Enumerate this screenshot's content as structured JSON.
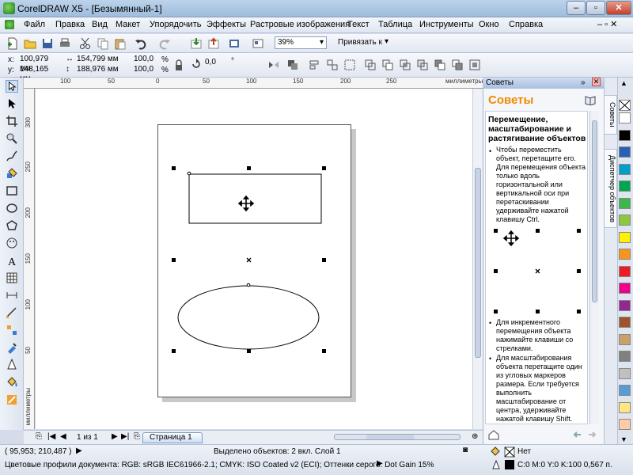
{
  "window": {
    "title": "CorelDRAW X5 - [Безымянный-1]"
  },
  "menu": [
    "Файл",
    "Правка",
    "Вид",
    "Макет",
    "Упорядочить",
    "Эффекты",
    "Растровые изображения",
    "Текст",
    "Таблица",
    "Инструменты",
    "Окно",
    "Справка"
  ],
  "standard_toolbar": {
    "zoom": "39%",
    "snap_label": "Привязать к"
  },
  "property_bar": {
    "x": "100,979 мм",
    "y": "148,165 мм",
    "width": "154,799 мм",
    "height": "188,976 мм",
    "scale_x": "100,0",
    "scale_y": "100,0",
    "percent": "%",
    "angle": "0,0",
    "angle_unit": "°",
    "x_label": "x:",
    "y_label": "y:"
  },
  "rulers": {
    "top": [
      "100",
      "50",
      "0",
      "50",
      "100",
      "150",
      "200",
      "250"
    ],
    "unit": "миллиметры",
    "left": [
      "300",
      "250",
      "200",
      "150",
      "100",
      "50"
    ]
  },
  "page_nav": {
    "count": "1 из 1",
    "tab": "Страница 1"
  },
  "docker": {
    "title": "Советы",
    "heading": "Советы",
    "tip_title": "Перемещение, масштабирование и растягивание объектов",
    "tip1": "Чтобы переместить объект, перетащите его. Для перемещения объекта только вдоль горизонтальной или вертикальной оси при перетаскивании удерживайте нажатой клавишу Ctrl.",
    "tip2": "Для инкрементного перемещения объекта нажимайте клавиши со стрелками.",
    "tip3": "Для масштабирования объекта перетащите один из угловых маркеров размера. Если требуется выполнить масштабирование от центра, удерживайте нажатой клавишу Shift.",
    "side_tab1": "Советы",
    "side_tab2": "Диспетчер объектов"
  },
  "status": {
    "coords": "( 95,953; 210,487 )",
    "selection": "Выделено объектов: 2 вкл. Слой 1",
    "fill": "Нет",
    "profiles": "Цветовые профили документа: RGB: sRGB IEC61966-2.1; CMYK: ISO Coated v2 (ECI); Оттенки серого: Dot Gain 15%",
    "outline": "C:0 M:0 Y:0 K:100  0,567 п."
  },
  "palette_colors": [
    "#ffffff",
    "#000000",
    "#2b5fb5",
    "#00a0c8",
    "#00a650",
    "#3cb84a",
    "#8dc63f",
    "#fff200",
    "#f7941d",
    "#ed1c24",
    "#ec008c",
    "#92278f",
    "#a0522d",
    "#c7a06a",
    "#808080",
    "#c0c0c0",
    "#5a9bd5",
    "#ffe680",
    "#fca"
  ]
}
